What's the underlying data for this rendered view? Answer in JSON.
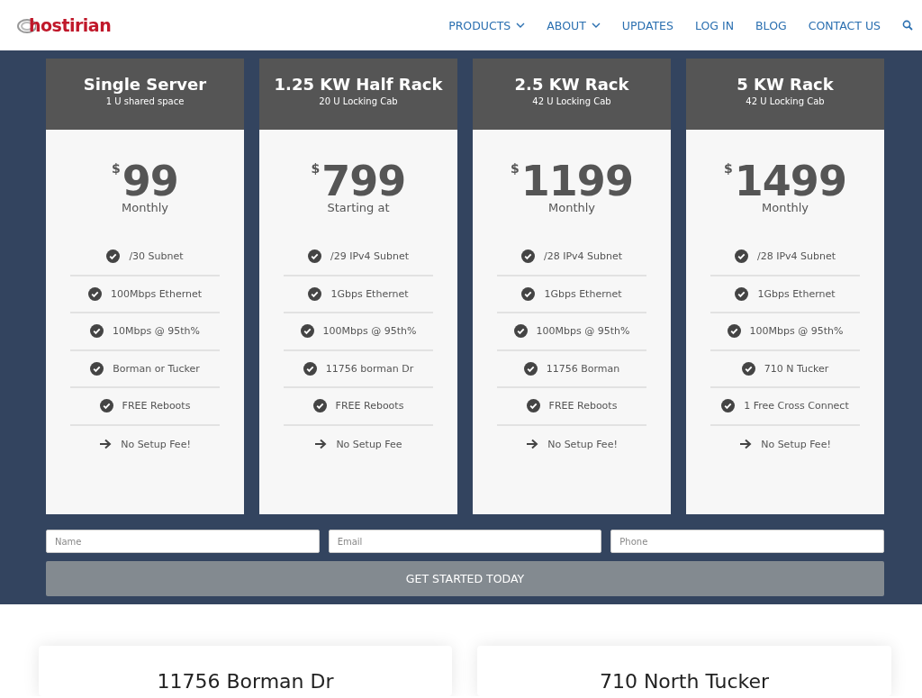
{
  "header": {
    "logo": "hostirian",
    "nav": [
      {
        "label": "PRODUCTS",
        "has_menu": true
      },
      {
        "label": "ABOUT",
        "has_menu": true
      },
      {
        "label": "UPDATES",
        "has_menu": false
      },
      {
        "label": "LOG IN",
        "has_menu": false
      },
      {
        "label": "BLOG",
        "has_menu": false
      },
      {
        "label": "CONTACT US",
        "has_menu": false
      }
    ]
  },
  "plans": [
    {
      "title": "Single Server",
      "subtitle": "1 U shared space",
      "currency": "$",
      "price": "99",
      "period": "Monthly",
      "features": [
        {
          "kind": "check",
          "text": "/30 Subnet"
        },
        {
          "kind": "check",
          "text": "100Mbps Ethernet"
        },
        {
          "kind": "check",
          "text": "10Mbps @ 95th%"
        },
        {
          "kind": "check",
          "text": "Borman or Tucker"
        },
        {
          "kind": "check",
          "text": "FREE Reboots"
        },
        {
          "kind": "arrow",
          "text": "No Setup Fee!"
        }
      ]
    },
    {
      "title": "1.25 KW Half Rack",
      "subtitle": "20 U Locking Cab",
      "currency": "$",
      "price": "799",
      "period": "Starting at",
      "features": [
        {
          "kind": "check",
          "text": "/29 IPv4 Subnet"
        },
        {
          "kind": "check",
          "text": "1Gbps Ethernet"
        },
        {
          "kind": "check",
          "text": "100Mbps @ 95th%"
        },
        {
          "kind": "check",
          "text": "11756 borman Dr"
        },
        {
          "kind": "check",
          "text": "FREE Reboots"
        },
        {
          "kind": "arrow",
          "text": "No Setup Fee"
        }
      ]
    },
    {
      "title": "2.5 KW Rack",
      "subtitle": "42 U Locking Cab",
      "currency": "$",
      "price": "1199",
      "period": "Monthly",
      "features": [
        {
          "kind": "check",
          "text": "/28 IPv4 Subnet"
        },
        {
          "kind": "check",
          "text": "1Gbps Ethernet"
        },
        {
          "kind": "check",
          "text": "100Mbps @ 95th%"
        },
        {
          "kind": "check",
          "text": "11756 Borman"
        },
        {
          "kind": "check",
          "text": "FREE Reboots"
        },
        {
          "kind": "arrow",
          "text": "No Setup Fee!"
        }
      ]
    },
    {
      "title": "5 KW Rack",
      "subtitle": "42 U Locking Cab",
      "currency": "$",
      "price": "1499",
      "period": "Monthly",
      "features": [
        {
          "kind": "check",
          "text": "/28 IPv4 Subnet"
        },
        {
          "kind": "check",
          "text": "1Gbps Ethernet"
        },
        {
          "kind": "check",
          "text": "100Mbps @ 95th%"
        },
        {
          "kind": "check",
          "text": "710 N Tucker"
        },
        {
          "kind": "check",
          "text": "1 Free Cross Connect"
        },
        {
          "kind": "arrow",
          "text": "No Setup Fee!"
        }
      ]
    }
  ],
  "form": {
    "fields": [
      {
        "placeholder": "Name"
      },
      {
        "placeholder": "Email"
      },
      {
        "placeholder": "Phone"
      }
    ],
    "submit": "GET STARTED TODAY"
  },
  "locations": [
    {
      "title": "11756 Borman Dr"
    },
    {
      "title": "710 North Tucker"
    }
  ]
}
